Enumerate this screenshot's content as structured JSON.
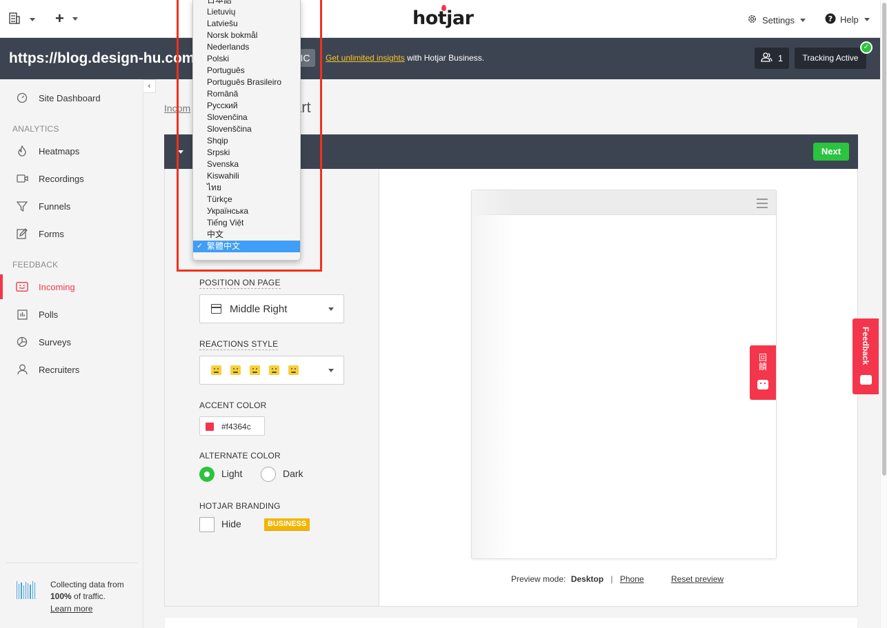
{
  "topbar": {
    "add_label": "+",
    "logo": "hotjar",
    "settings_label": "Settings",
    "help_label": "Help"
  },
  "sitebar": {
    "url": "https://blog.design-hu.com/",
    "badge": "IC",
    "promo_link": "Get unlimited insights",
    "promo_rest": " with Hotjar Business.",
    "users_count": "1",
    "tracking_label": "Tracking Active"
  },
  "sidebar": {
    "dashboard": "Site Dashboard",
    "analytics_header": "ANALYTICS",
    "analytics_items": [
      "Heatmaps",
      "Recordings",
      "Funnels",
      "Forms"
    ],
    "feedback_header": "FEEDBACK",
    "feedback_items": [
      "Incoming",
      "Polls",
      "Surveys",
      "Recruiters"
    ],
    "active_item": "Incoming",
    "footer_text_1": "Collecting data from",
    "footer_text_bold": "100%",
    "footer_text_2": " of traffic.",
    "footer_link": "Learn more"
  },
  "main": {
    "breadcrumb": "Incom",
    "title_fragment": "art",
    "next_label": "Next",
    "position_label": "POSITION ON PAGE",
    "position_value": "Middle Right",
    "reactions_label": "REACTIONS STYLE",
    "accent_label": "ACCENT COLOR",
    "accent_value": "#f4364c",
    "alternate_label": "ALTERNATE COLOR",
    "alt_light": "Light",
    "alt_dark": "Dark",
    "alt_selected": "Light",
    "branding_label": "HOTJAR BRANDING",
    "branding_hide": "Hide",
    "branding_badge": "BUSINESS"
  },
  "preview": {
    "widget_text": "回饋",
    "mode_label": "Preview mode:",
    "mode_desktop": "Desktop",
    "mode_sep": "|",
    "mode_phone": "Phone",
    "reset": "Reset preview"
  },
  "side_feedback": "Feedback",
  "language_dropdown": {
    "options": [
      "日本語",
      "Lietuvių",
      "Latviešu",
      "Norsk bokmål",
      "Nederlands",
      "Polski",
      "Português",
      "Português Brasileiro",
      "Română",
      "Русский",
      "Slovenčina",
      "Slovenščina",
      "Shqip",
      "Srpski",
      "Svenska",
      "Kiswahili",
      "ไทย",
      "Türkçe",
      "Українська",
      "Tiếng Việt",
      "中文",
      "繁體中文"
    ],
    "selected": "繁體中文"
  },
  "colors": {
    "accent": "#f4364c",
    "success": "#2bc33f",
    "dark_bar": "#3d4451",
    "selection": "#3f9ef5",
    "highlight": "#f1311c"
  }
}
